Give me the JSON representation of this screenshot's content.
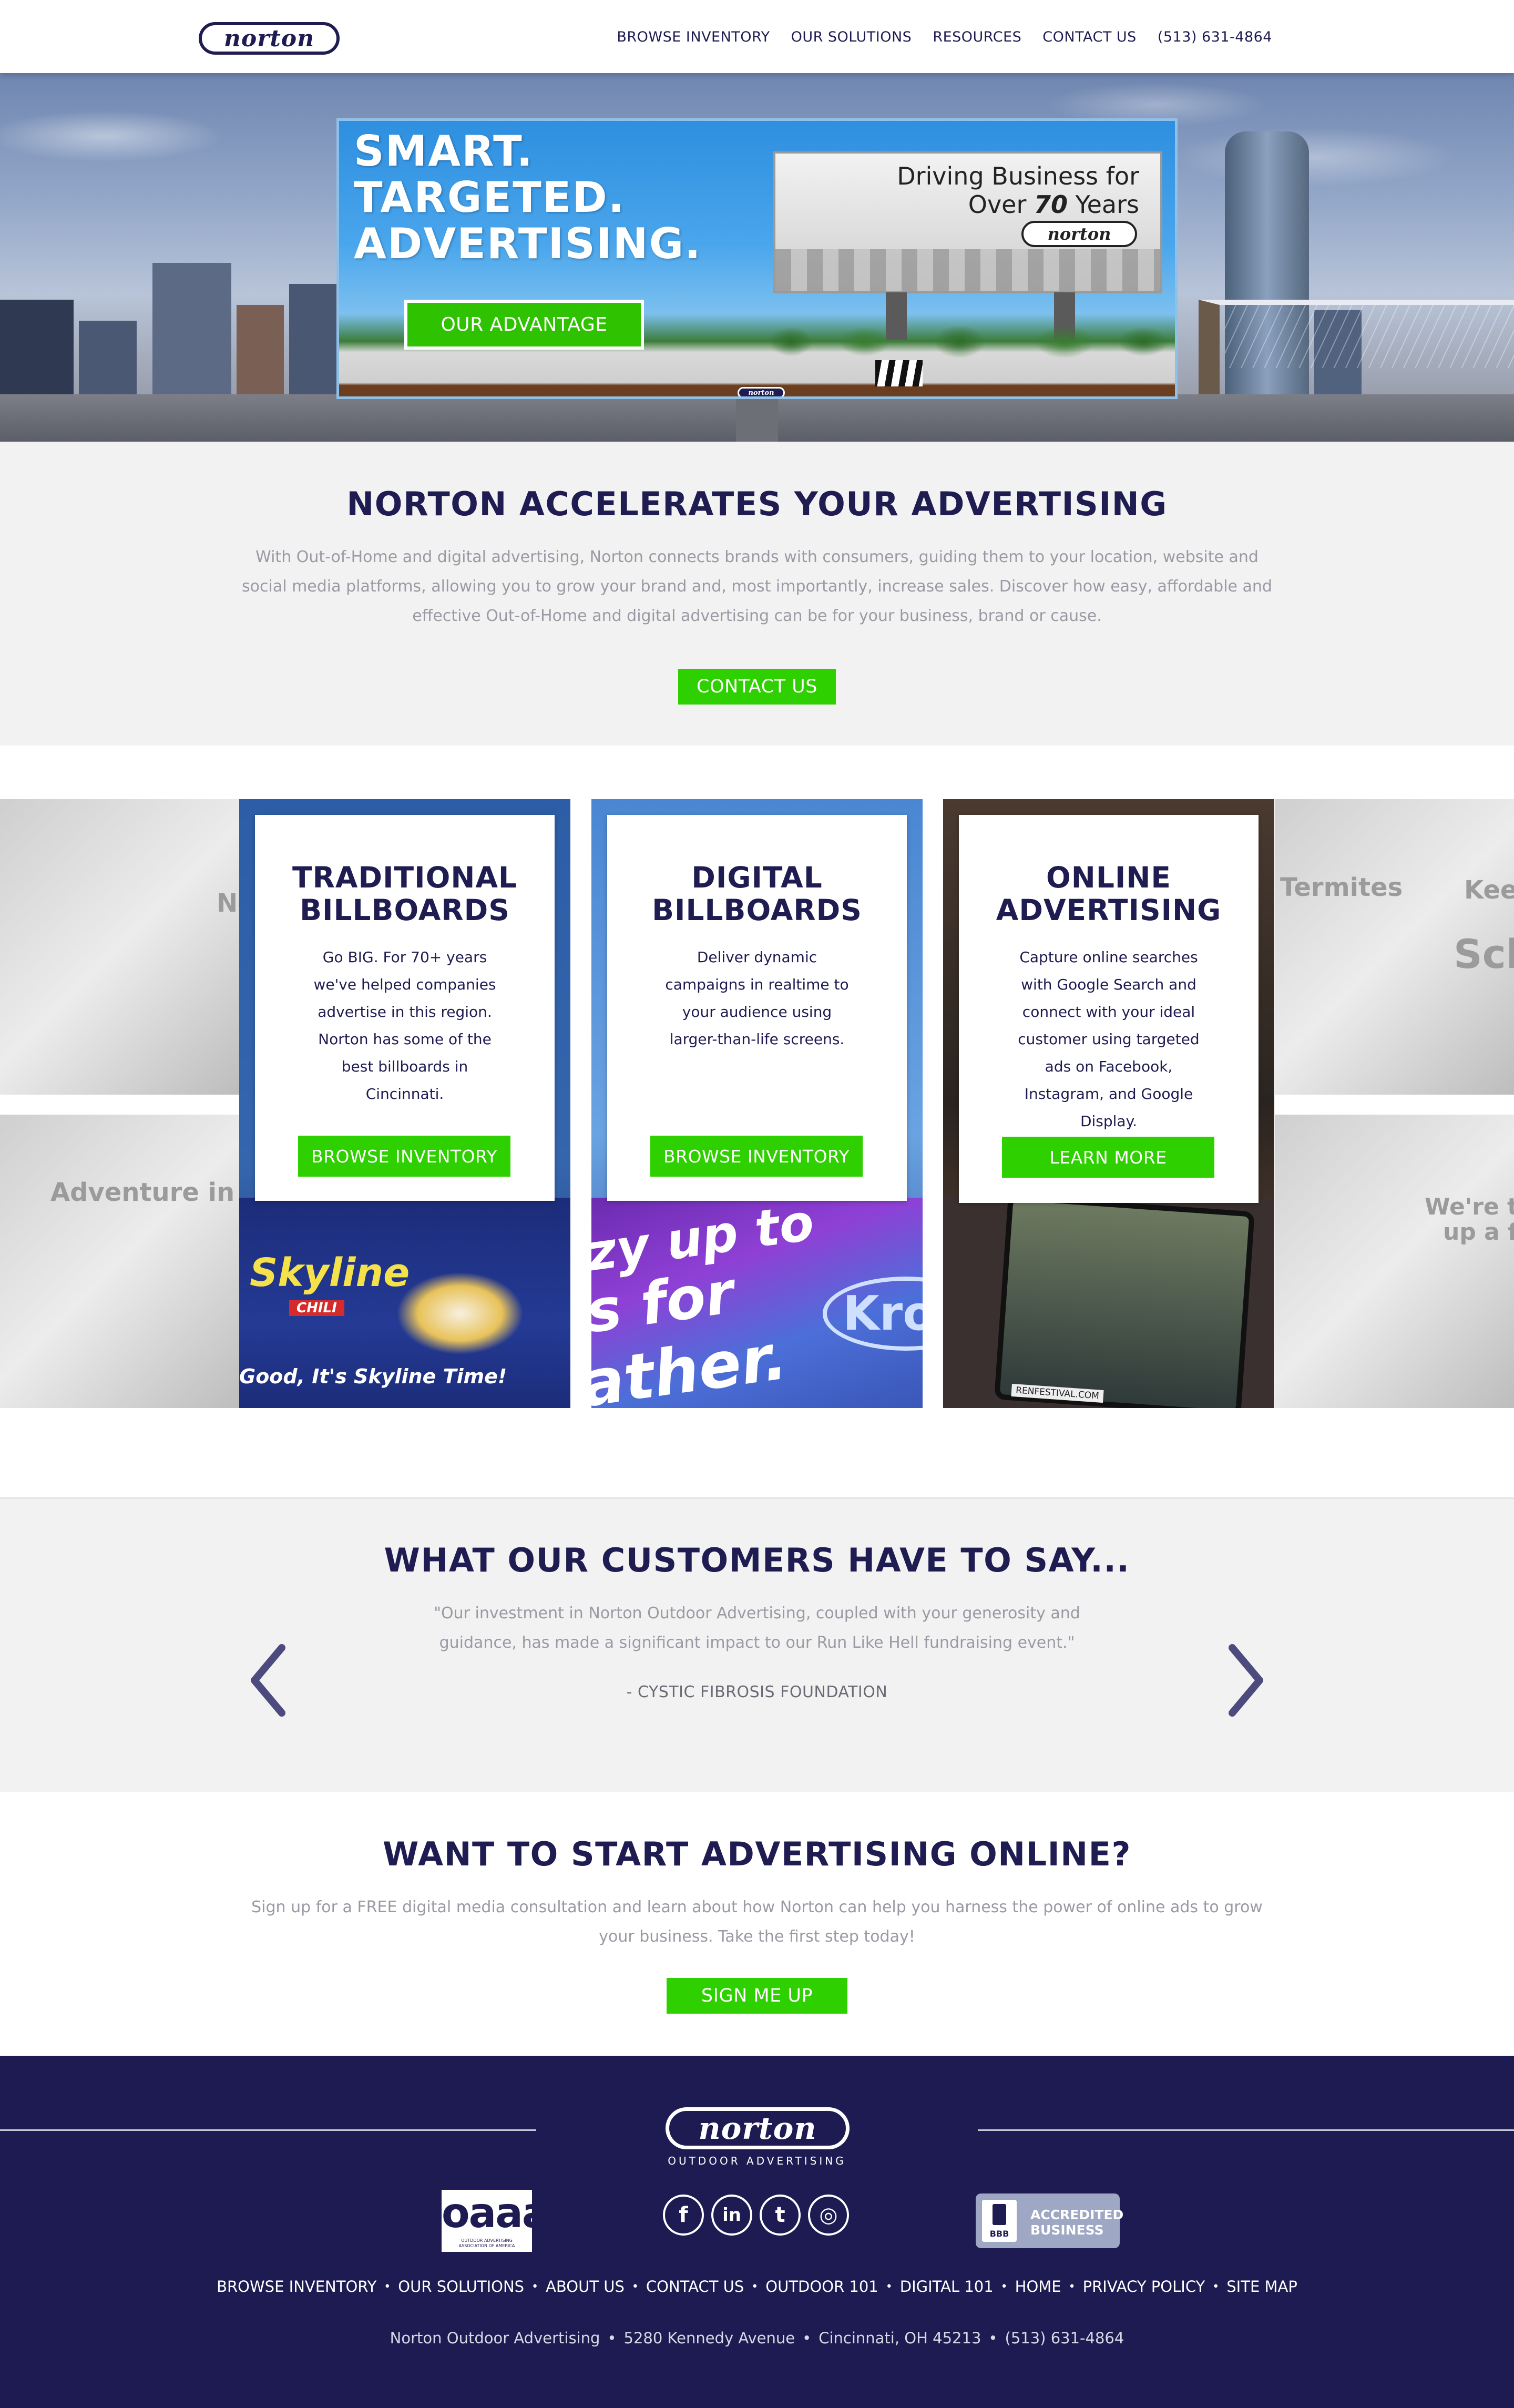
{
  "header": {
    "logo_text": "norton",
    "nav": [
      "BROWSE INVENTORY",
      "OUR SOLUTIONS",
      "RESOURCES",
      "CONTACT US",
      "(513) 631-4864"
    ]
  },
  "hero": {
    "headline": [
      "SMART.",
      "TARGETED.",
      "ADVERTISING."
    ],
    "cta": "OUR ADVANTAGE",
    "mini_billboard_line1": "Driving Business for",
    "mini_billboard_line2_pre": "Over ",
    "mini_billboard_line2_num": "70",
    "mini_billboard_line2_post": " Years",
    "mini_logo": "norton",
    "tag_logo": "norton"
  },
  "accelerate": {
    "title": "NORTON ACCELERATES YOUR ADVERTISING",
    "body": "With Out-of-Home and digital advertising, Norton connects brands with consumers, guiding them to your location, website and social media platforms, allowing you to grow your brand and, most importantly, increase sales. Discover how easy, affordable and effective Out-of-Home and digital advertising can be for your business, brand or cause.",
    "cta": "CONTACT US"
  },
  "services": {
    "side_labels": [
      "No",
      "Adventure in Refres",
      "Termites",
      "Keep",
      "Sch",
      "We're tur",
      "up a fev"
    ],
    "cards": [
      {
        "title_line1": "TRADITIONAL",
        "title_line2": "BILLBOARDS",
        "body": "Go BIG. For 70+ years we've helped companies advertise in this region. Norton has some of the best billboards in Cincinnati.",
        "cta": "BROWSE INVENTORY",
        "photo_text": "Good, It's Skyline Time!",
        "photo_brand": "Skyline",
        "photo_brand_sub": "CHILI"
      },
      {
        "title_line1": "DIGITAL",
        "title_line2": "BILLBOARDS",
        "body": "Deliver dynamic campaigns in realtime to your audience using larger-than-life screens.",
        "cta": "BROWSE INVENTORY",
        "photo_text": "zy up to",
        "photo_text2": "s for",
        "photo_text3": "ather.",
        "photo_brand": "Krog"
      },
      {
        "title_line1": "ONLINE",
        "title_line2": "ADVERTISING",
        "body": "Capture online searches with Google Search and connect with your ideal customer using targeted ads on Facebook, Instagram, and Google Display.",
        "cta": "LEARN MORE",
        "photo_text": "RENFESTIVAL.COM"
      }
    ]
  },
  "testimonial": {
    "title": "WHAT OUR CUSTOMERS HAVE TO SAY...",
    "quote": "\"Our investment in Norton Outdoor Advertising, coupled with your generosity and guidance, has made a significant impact to our Run Like Hell fundraising event.\"",
    "attribution": "- CYSTIC FIBROSIS FOUNDATION"
  },
  "online": {
    "title": "WANT TO START ADVERTISING ONLINE?",
    "body": "Sign up for a FREE digital media consultation and learn about how Norton can help you harness the power of online ads to grow your business. Take the first step today!",
    "cta": "SIGN ME UP"
  },
  "footer": {
    "logo_text": "norton",
    "logo_sub": "OUTDOOR ADVERTISING",
    "oaaa_text": "oaaa",
    "oaaa_sub": "OUTDOOR ADVERTISING ASSOCIATION OF AMERICA",
    "social_icons": [
      "facebook-icon",
      "linkedin-icon",
      "twitter-icon",
      "instagram-icon"
    ],
    "social_glyphs": [
      "f",
      "in",
      "t",
      "◎"
    ],
    "bbb_seal": "BBB",
    "bbb_line1": "ACCREDITED",
    "bbb_line2": "BUSINESS",
    "links": [
      "BROWSE INVENTORY",
      "OUR SOLUTIONS",
      "ABOUT US",
      "CONTACT US",
      "OUTDOOR 101",
      "DIGITAL 101",
      "HOME",
      "PRIVACY POLICY",
      "SITE MAP"
    ],
    "address": [
      "Norton Outdoor Advertising",
      "5280 Kennedy Avenue",
      "Cincinnati, OH 45213",
      "(513) 631-4864"
    ],
    "separator": "•"
  },
  "colors": {
    "navy": "#1f1c52",
    "green": "#2fd000",
    "footer_bg": "#1e1b52",
    "section_grey": "#f2f2f2"
  }
}
